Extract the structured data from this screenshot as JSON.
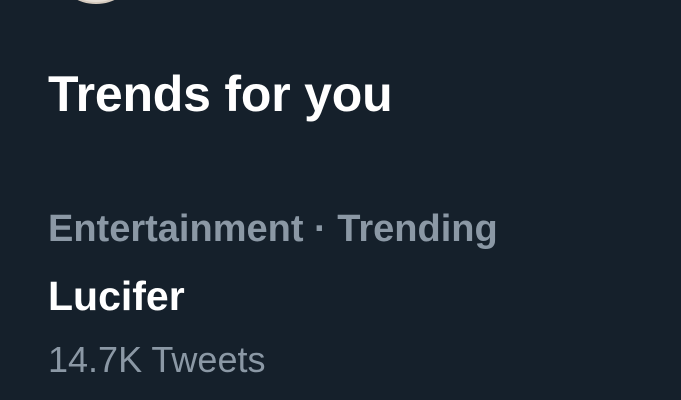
{
  "colors": {
    "background": "#15202b",
    "primary_text": "#ffffff",
    "secondary_text": "#8b98a5",
    "avatar": "#e7dfd6"
  },
  "section": {
    "title": "Trends for you"
  },
  "trend": {
    "category": "Entertainment",
    "separator": " · ",
    "status": "Trending",
    "name": "Lucifer",
    "tweet_count": "14.7K Tweets"
  }
}
